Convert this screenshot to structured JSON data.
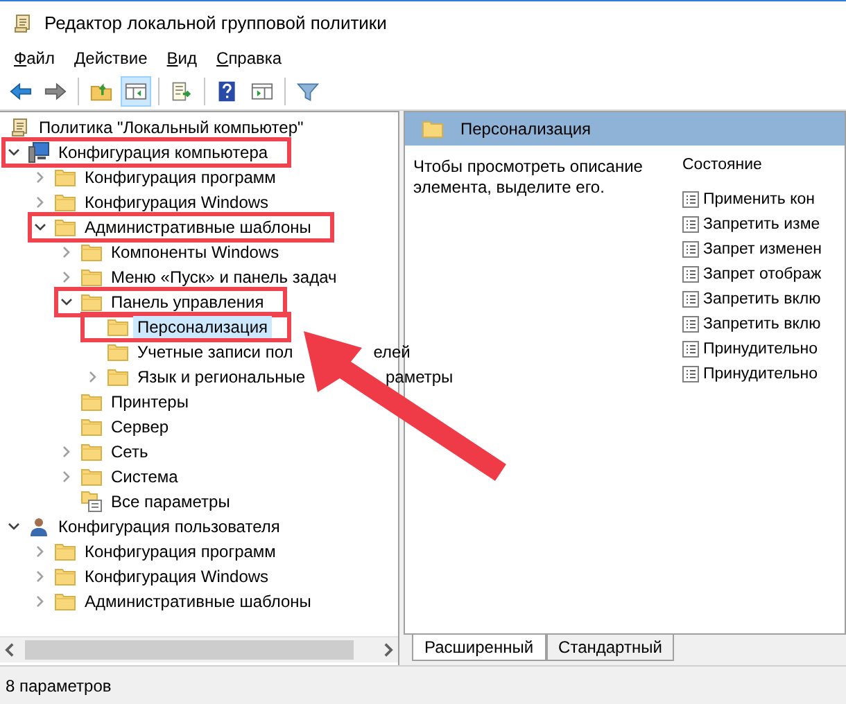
{
  "window": {
    "title": "Редактор локальной групповой политики"
  },
  "menu": [
    "Файл",
    "Действие",
    "Вид",
    "Справка"
  ],
  "toolbar": [
    {
      "kind": "back",
      "pressed": false
    },
    {
      "kind": "forward",
      "pressed": false
    },
    {
      "kind": "separator"
    },
    {
      "kind": "up",
      "pressed": false
    },
    {
      "kind": "tree",
      "pressed": true
    },
    {
      "kind": "separator"
    },
    {
      "kind": "export",
      "pressed": false
    },
    {
      "kind": "separator"
    },
    {
      "kind": "help",
      "pressed": false
    },
    {
      "kind": "panel",
      "pressed": false
    },
    {
      "kind": "separator"
    },
    {
      "kind": "filter",
      "pressed": false
    }
  ],
  "tree": [
    {
      "label": "Политика \"Локальный компьютер\"",
      "kind": "policy",
      "selected": false,
      "highlighted": false,
      "children": [
        {
          "label": "Конфигурация компьютера",
          "kind": "computer",
          "expanded": true,
          "selected": false,
          "highlighted": true,
          "children": [
            {
              "label": "Конфигурация программ",
              "kind": "folder",
              "expanded": false,
              "selected": false,
              "highlighted": false
            },
            {
              "label": "Конфигурация Windows",
              "kind": "folder",
              "expanded": false,
              "selected": false,
              "highlighted": false
            },
            {
              "label": "Административные шаблоны",
              "kind": "folder",
              "expanded": true,
              "selected": false,
              "highlighted": true,
              "children": [
                {
                  "label": "Компоненты Windows",
                  "kind": "folder",
                  "expanded": false,
                  "selected": false,
                  "highlighted": false
                },
                {
                  "label": "Меню «Пуск» и панель задач",
                  "kind": "folder",
                  "expanded": false,
                  "selected": false,
                  "highlighted": false
                },
                {
                  "label": "Панель управления",
                  "kind": "folder",
                  "expanded": true,
                  "selected": false,
                  "highlighted": true,
                  "children": [
                    {
                      "label": "Персонализация",
                      "kind": "folder",
                      "selected": true,
                      "highlighted": true
                    },
                    {
                      "label": "Учетные записи пол",
                      "label_tail": "елей",
                      "kind": "folder",
                      "selected": false,
                      "highlighted": false
                    },
                    {
                      "label": "Язык и региональные",
                      "label_tail": "раметры",
                      "kind": "folder",
                      "expanded": false,
                      "selected": false,
                      "highlighted": false
                    }
                  ]
                },
                {
                  "label": "Принтеры",
                  "kind": "folder",
                  "selected": false,
                  "highlighted": false
                },
                {
                  "label": "Сервер",
                  "kind": "folder",
                  "selected": false,
                  "highlighted": false
                },
                {
                  "label": "Сеть",
                  "kind": "folder",
                  "expanded": false,
                  "selected": false,
                  "highlighted": false
                },
                {
                  "label": "Система",
                  "kind": "folder",
                  "expanded": false,
                  "selected": false,
                  "highlighted": false
                },
                {
                  "label": "Все параметры",
                  "kind": "settings",
                  "selected": false,
                  "highlighted": false
                }
              ]
            }
          ]
        },
        {
          "label": "Конфигурация пользователя",
          "kind": "user",
          "expanded": true,
          "selected": false,
          "highlighted": false,
          "children": [
            {
              "label": "Конфигурация программ",
              "kind": "folder",
              "expanded": false,
              "selected": false,
              "highlighted": false
            },
            {
              "label": "Конфигурация Windows",
              "kind": "folder",
              "expanded": false,
              "selected": false,
              "highlighted": false
            },
            {
              "label": "Административные шаблоны",
              "kind": "folder",
              "expanded": false,
              "selected": false,
              "highlighted": false
            }
          ]
        }
      ]
    }
  ],
  "details": {
    "title": "Персонализация",
    "description": "Чтобы просмотреть описание элемента, выделите его.",
    "column": "Состояние",
    "items": [
      "Применить кон",
      "Запретить изме",
      "Запрет изменен",
      "Запрет отображ",
      "Запретить вклю",
      "Запретить вклю",
      "Принудительно",
      "Принудительно"
    ]
  },
  "tabs": [
    {
      "label": "Расширенный",
      "selected": true
    },
    {
      "label": "Стандартный",
      "selected": false
    }
  ],
  "status_bar": "8 параметров"
}
